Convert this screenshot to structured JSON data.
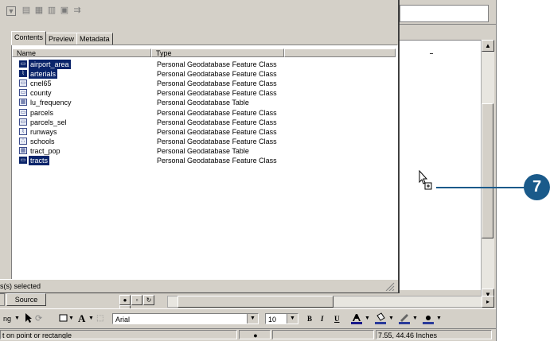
{
  "catalog": {
    "tabs": [
      {
        "label": "Contents",
        "active": true
      },
      {
        "label": "Preview",
        "active": false
      },
      {
        "label": "Metadata",
        "active": false
      }
    ],
    "columns": {
      "name": "Name",
      "type": "Type"
    },
    "rows": [
      {
        "name": "airport_area",
        "type": "Personal Geodatabase Feature Class",
        "icon": "polygon-feature-class-icon",
        "selected": true
      },
      {
        "name": "arterials",
        "type": "Personal Geodatabase Feature Class",
        "icon": "line-feature-class-icon",
        "selected": true
      },
      {
        "name": "cnel65",
        "type": "Personal Geodatabase Feature Class",
        "icon": "polygon-feature-class-icon",
        "selected": false
      },
      {
        "name": "county",
        "type": "Personal Geodatabase Feature Class",
        "icon": "polygon-feature-class-icon",
        "selected": false
      },
      {
        "name": "lu_frequency",
        "type": "Personal Geodatabase Table",
        "icon": "table-icon",
        "selected": false
      },
      {
        "name": "parcels",
        "type": "Personal Geodatabase Feature Class",
        "icon": "polygon-feature-class-icon",
        "selected": false
      },
      {
        "name": "parcels_sel",
        "type": "Personal Geodatabase Feature Class",
        "icon": "polygon-feature-class-icon",
        "selected": false
      },
      {
        "name": "runways",
        "type": "Personal Geodatabase Feature Class",
        "icon": "line-feature-class-icon",
        "selected": false
      },
      {
        "name": "schools",
        "type": "Personal Geodatabase Feature Class",
        "icon": "point-feature-class-icon",
        "selected": false
      },
      {
        "name": "tract_pop",
        "type": "Personal Geodatabase Table",
        "icon": "table-icon",
        "selected": false
      },
      {
        "name": "tracts",
        "type": "Personal Geodatabase Feature Class",
        "icon": "polygon-feature-class-icon",
        "selected": true
      }
    ],
    "status": "s(s) selected"
  },
  "toc": {
    "source_tab": "Source"
  },
  "draw_toolbar": {
    "drawing_label": "ng",
    "font_name": "Arial",
    "font_size": "10",
    "bold": "B",
    "italic": "I",
    "underline": "U",
    "text_tool": "A"
  },
  "status_bar": {
    "message": "t on point or rectangle",
    "coordinates": "7.55, 44.46 Inches"
  },
  "callout": {
    "number": "7",
    "color": "#1a5a8a"
  },
  "colors": {
    "selection": "#0a246a",
    "chrome": "#d4d0c8"
  }
}
